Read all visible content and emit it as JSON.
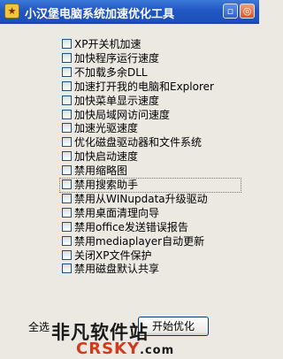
{
  "window": {
    "title": "小汉堡电脑系统加速优化工具",
    "icons": {
      "app": "app-icon",
      "minimize": "minimize-icon",
      "close": "close-icon"
    }
  },
  "options": [
    {
      "label": "XP开关机加速"
    },
    {
      "label": "加快程序运行速度"
    },
    {
      "label": "不加载多余DLL"
    },
    {
      "label": "加速打开我的电脑和Explorer"
    },
    {
      "label": "加快菜单显示速度"
    },
    {
      "label": "加快局域网访问速度"
    },
    {
      "label": "加速光驱速度"
    },
    {
      "label": "优化磁盘驱动器和文件系统"
    },
    {
      "label": "加快启动速度"
    },
    {
      "label": "禁用缩略图"
    },
    {
      "label": "禁用搜索助手"
    },
    {
      "label": "禁用从WINupdata升级驱动"
    },
    {
      "label": "禁用桌面清理向导"
    },
    {
      "label": "禁用office发送错误报告"
    },
    {
      "label": "禁用mediaplayer自动更新"
    },
    {
      "label": "关闭XP文件保护"
    },
    {
      "label": "禁用磁盘默认共享"
    }
  ],
  "footer": {
    "select_all_label": "全选",
    "start_button": "开始优化"
  },
  "watermark": {
    "top": "非凡软件站",
    "bottom": "CRSKY",
    "suffix": ".com"
  }
}
